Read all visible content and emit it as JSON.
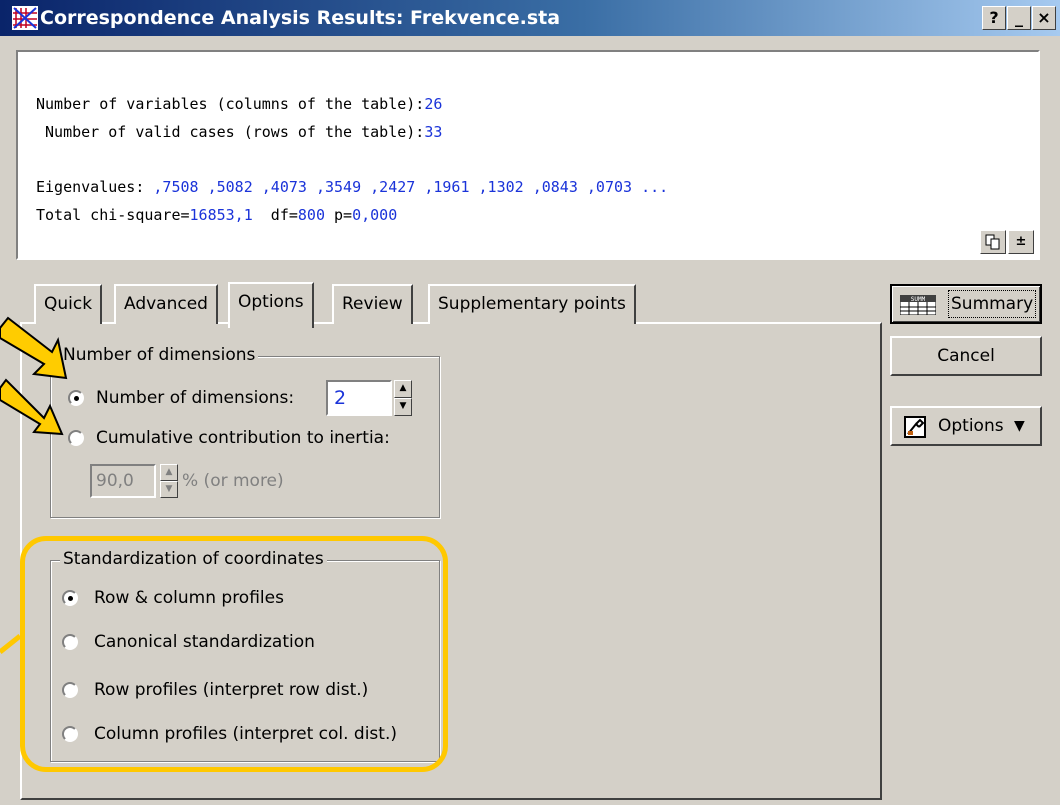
{
  "window": {
    "title": "Correspondence Analysis Results: Frekvence.sta",
    "buttons": {
      "help": "?",
      "minimize": "_",
      "close": "×"
    }
  },
  "output": {
    "variables_label": "Number of variables (columns of the table):",
    "variables_value": "26",
    "cases_label": " Number of valid cases (rows of the table):",
    "cases_value": "33",
    "eigen_label": "Eigenvalues: ",
    "eigen_values": ",7508 ,5082 ,4073 ,3549 ,2427 ,1961 ,1302 ,0843 ,0703 ...",
    "chi_label": "Total chi-square=",
    "chi_value": "16853,1",
    "df_label": "  df=",
    "df_value": "800",
    "p_label": " p=",
    "p_value": "0,000"
  },
  "tabs": [
    "Quick",
    "Advanced",
    "Options",
    "Review",
    "Supplementary points"
  ],
  "active_tab": "Options",
  "dimensions_group": {
    "legend": "Number of dimensions",
    "option_number": "Number of dimensions:",
    "number_value": "2",
    "option_cumulative": "Cumulative contribution to inertia:",
    "cumulative_value": "90,0",
    "cumulative_suffix": "% (or more)",
    "selected": "number"
  },
  "standardization_group": {
    "legend": "Standardization of coordinates",
    "options": [
      "Row & column profiles",
      "Canonical standardization",
      "Row profiles (interpret row dist.)",
      "Column profiles (interpret col. dist.)"
    ],
    "selected_index": 0
  },
  "side_buttons": {
    "summary": "Summary",
    "cancel": "Cancel",
    "options": "Options"
  },
  "colors": {
    "highlight": "#ffc800",
    "value_text": "#1a33d9",
    "titlebar_start": "#0a246a"
  }
}
